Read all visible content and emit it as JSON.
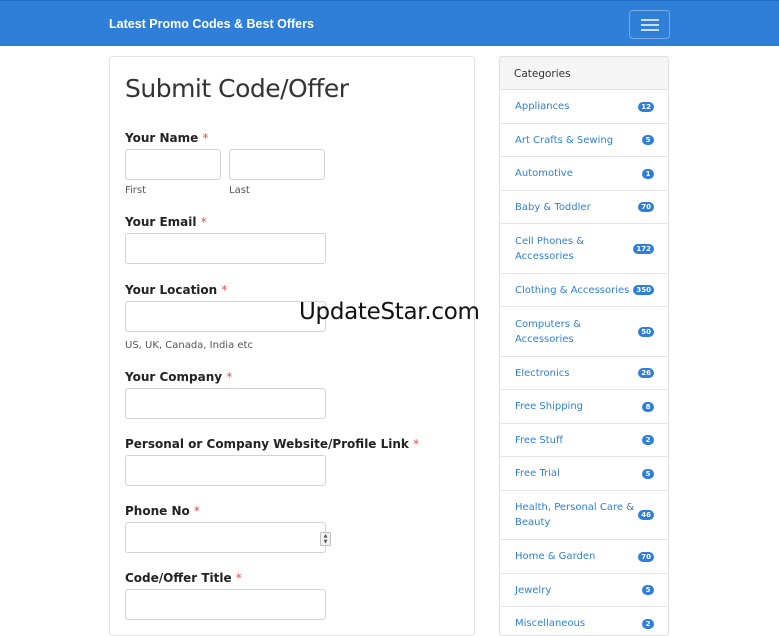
{
  "navbar": {
    "brand": "Latest Promo Codes & Best Offers",
    "toggler_icon": "hamburger-menu-icon"
  },
  "form": {
    "title": "Submit Code/Offer",
    "required_mark": "*",
    "name_label": "Your Name",
    "first_help": "First",
    "last_help": "Last",
    "email_label": "Your Email",
    "location_label": "Your Location",
    "location_help": "US, UK, Canada, India etc",
    "company_label": "Your Company",
    "website_label": "Personal or Company Website/Profile Link",
    "phone_label": "Phone No",
    "title_label": "Code/Offer Title",
    "spinner_up": "▲",
    "spinner_down": "▼"
  },
  "categories": {
    "header": "Categories",
    "items": [
      {
        "label": "Appliances",
        "count": "12"
      },
      {
        "label": "Art Crafts & Sewing",
        "count": "5"
      },
      {
        "label": "Automotive",
        "count": "1"
      },
      {
        "label": "Baby & Toddler",
        "count": "70"
      },
      {
        "label": "Cell Phones & Accessories",
        "count": "172"
      },
      {
        "label": "Clothing & Accessories",
        "count": "350"
      },
      {
        "label": "Computers & Accessories",
        "count": "50"
      },
      {
        "label": "Electronics",
        "count": "26"
      },
      {
        "label": "Free Shipping",
        "count": "8"
      },
      {
        "label": "Free Stuff",
        "count": "2"
      },
      {
        "label": "Free Trial",
        "count": "5"
      },
      {
        "label": "Health, Personal Care & Beauty",
        "count": "46"
      },
      {
        "label": "Home & Garden",
        "count": "70"
      },
      {
        "label": "Jewelry",
        "count": "5"
      },
      {
        "label": "Miscellaneous",
        "count": "2"
      }
    ]
  },
  "watermark": "UpdateStar.com",
  "colors": {
    "navbar": "#2f7fd8",
    "link": "#2f7fd8",
    "badge": "#2f7fd8",
    "required": "#d9534f"
  }
}
